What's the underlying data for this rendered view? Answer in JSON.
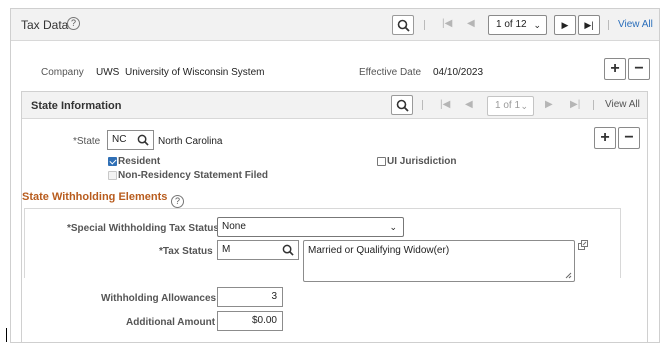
{
  "header": {
    "title": "Tax Data",
    "help_icon": "?",
    "search_icon": "search-icon",
    "pager": "1 of 12",
    "view_all": "View All"
  },
  "company": {
    "label": "Company",
    "code": "UWS",
    "name": "University of Wisconsin System",
    "effective_date_label": "Effective Date",
    "effective_date": "04/10/2023"
  },
  "state_info": {
    "title": "State Information",
    "pager": "1 of 1",
    "view_all": "View All",
    "state_label": "*State",
    "state_code": "NC",
    "state_name": "North Carolina",
    "resident_label": "Resident",
    "resident_checked": true,
    "ui_jurisdiction_label": "UI Jurisdiction",
    "ui_jurisdiction_checked": false,
    "non_residency_label": "Non-Residency Statement Filed",
    "non_residency_checked": false
  },
  "withholding": {
    "title": "State Withholding Elements",
    "special_status_label": "*Special Withholding Tax Status",
    "special_status_value": "None",
    "tax_status_label": "*Tax Status",
    "tax_status_code": "M",
    "tax_status_desc": "Married or Qualifying Widow(er)",
    "allowances_label": "Withholding Allowances",
    "allowances_value": "3",
    "additional_amount_label": "Additional Amount",
    "additional_amount_value": "$0.00"
  },
  "colors": {
    "accent_link": "#2a6ebb",
    "section_title": "#b85c1e",
    "checkbox_on": "#2f6fb5"
  }
}
